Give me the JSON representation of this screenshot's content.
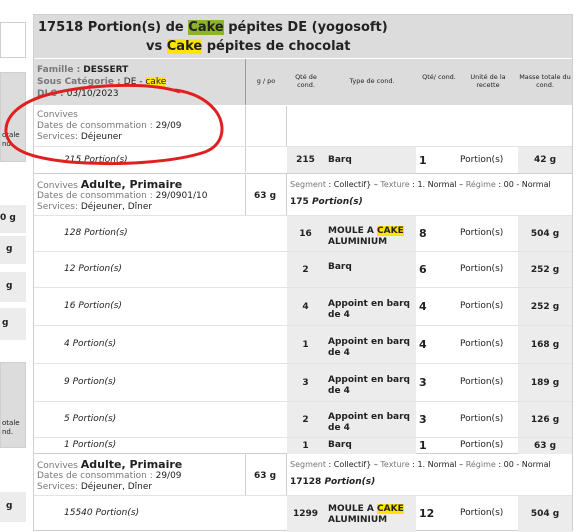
{
  "title": {
    "line1_pre": "17518 Portion(s) de ",
    "line1_hl": "Cake",
    "line1_post": " pépites DE (yogosoft)",
    "line2_pre": "vs ",
    "line2_hl": "Cake",
    "line2_post": " pépites de chocolat"
  },
  "info": {
    "famille_label": "Famille : ",
    "famille_value": "DESSERT",
    "souscat_label": "Sous Catégorie : ",
    "souscat_value": "DE - ",
    "souscat_hl": "cake",
    "dlc_label": "DLC : ",
    "dlc_value": "03/10/2023"
  },
  "columns": {
    "g_po": "g / po",
    "qte_cond": "Qté de cond.",
    "type_cond": "Type de cond.",
    "qte_cond2": "Qté/ cond.",
    "unite_recette": "Unité de la recette",
    "masse_totale": "Masse totale du cond."
  },
  "section1": {
    "convives": "Convives",
    "dates_label": "Dates de consommation",
    "dates_value": "29/09",
    "services_label": "Services:",
    "services_value": "Déjeuner",
    "row": {
      "portions": "215",
      "unit": "Portion(s)",
      "qty": "215",
      "type": "Barq",
      "per": "1",
      "unite": "Portion(s)",
      "masse": "42 g"
    }
  },
  "section2": {
    "convives": "Convives",
    "convives_value": "Adulte, Primaire",
    "dates_label": "Dates de consommation",
    "dates_value": "29/0901/10",
    "services_label": "Services:",
    "services_value": "Déjeuner, Dîner",
    "gpo": "63 g",
    "segment_label": "Segment",
    "segment_value": "Collectif} –",
    "texture_label": "Texture",
    "texture_value": "1. Normal –",
    "regime_label": "Régime",
    "regime_value": "00 - Normal",
    "total": "175",
    "total_unit": "Portion(s)",
    "rows": [
      {
        "portions": "128",
        "unit": "Portion(s)",
        "qty": "16",
        "type_pre": "MOULE A ",
        "type_hl": "CAKE",
        "type_post": " ALUMINIUM",
        "per": "8",
        "unite": "Portion(s)",
        "masse": "504 g"
      },
      {
        "portions": "12",
        "unit": "Portion(s)",
        "qty": "2",
        "type_pre": "Barq",
        "type_hl": "",
        "type_post": "",
        "per": "6",
        "unite": "Portion(s)",
        "masse": "252 g"
      },
      {
        "portions": "16",
        "unit": "Portion(s)",
        "qty": "4",
        "type_pre": "Appoint en barq de 4",
        "type_hl": "",
        "type_post": "",
        "per": "4",
        "unite": "Portion(s)",
        "masse": "252 g"
      },
      {
        "portions": "4",
        "unit": "Portion(s)",
        "qty": "1",
        "type_pre": "Appoint en barq de 4",
        "type_hl": "",
        "type_post": "",
        "per": "4",
        "unite": "Portion(s)",
        "masse": "168 g"
      },
      {
        "portions": "9",
        "unit": "Portion(s)",
        "qty": "3",
        "type_pre": "Appoint en barq de 4",
        "type_hl": "",
        "type_post": "",
        "per": "3",
        "unite": "Portion(s)",
        "masse": "189 g"
      },
      {
        "portions": "5",
        "unit": "Portion(s)",
        "qty": "2",
        "type_pre": "Appoint en barq de 4",
        "type_hl": "",
        "type_post": "",
        "per": "3",
        "unite": "Portion(s)",
        "masse": "126 g"
      },
      {
        "portions": "1",
        "unit": "Portion(s)",
        "qty": "1",
        "type_pre": "Barq",
        "type_hl": "",
        "type_post": "",
        "per": "1",
        "unite": "Portion(s)",
        "masse": "63 g"
      }
    ]
  },
  "section3": {
    "convives": "Convives",
    "convives_value": "Adulte, Primaire",
    "dates_label": "Dates de consommation",
    "dates_value": "29/09",
    "services_label": "Services:",
    "services_value": "Déjeuner, Dîner",
    "gpo": "63 g",
    "segment_label": "Segment",
    "segment_value": "Collectif} –",
    "texture_label": "Texture",
    "texture_value": "1. Normal –",
    "regime_label": "Régime",
    "regime_value": "00 - Normal",
    "total": "17128",
    "total_unit": "Portion(s)",
    "row": {
      "portions": "15540",
      "unit": "Portion(s)",
      "qty": "1299",
      "type_pre": "MOULE A ",
      "type_hl": "CAKE",
      "type_post": " ALUMINIUM",
      "per": "12",
      "unite": "Portion(s)",
      "masse": "504 g"
    }
  },
  "left_panel": {
    "frag1": "otale",
    "frag1b": "nd.",
    "g0": "0 g",
    "g1": "g",
    "g2": "g",
    "g3": "g",
    "frag2": "otale",
    "frag2b": "nd.",
    "g4": "g"
  },
  "colors": {
    "highlight_green": "#8db32a",
    "highlight_yellow": "#ffe600",
    "annotation_red": "#e02020"
  }
}
